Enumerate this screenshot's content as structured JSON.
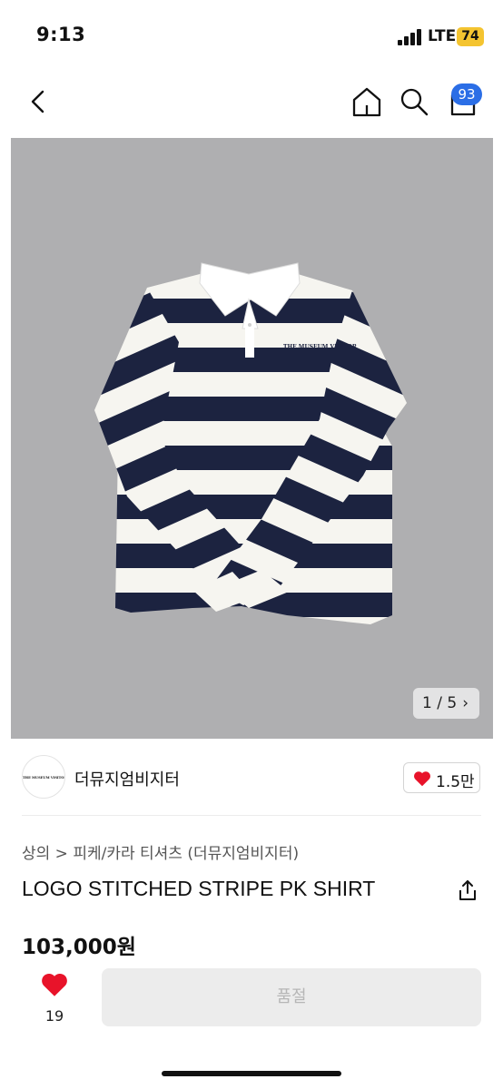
{
  "status_bar": {
    "time": "9:13",
    "network": "LTE",
    "battery": "74"
  },
  "nav": {
    "cart_count": "93"
  },
  "image": {
    "counter": "1 / 5",
    "next_glyph": "›",
    "brand_print": "THE MUSEUM VISITOR"
  },
  "brand": {
    "logo_text": "THE MUSEUM VISITOR",
    "name": "더뮤지엄비지터",
    "likes": "1.5만"
  },
  "product": {
    "breadcrumb": "상의 > 피케/카라 티셔츠 (더뮤지엄비지터)",
    "title": "LOGO STITCHED STRIPE PK SHIRT",
    "price": "103,000원"
  },
  "bottom": {
    "wish_count": "19",
    "buy_label": "품절"
  },
  "colors": {
    "accent": "#2b6ee6",
    "heart": "#e8132a",
    "image_bg": "#afafb1",
    "navy_stripe": "#1c2340",
    "battery": "#f4c430"
  }
}
